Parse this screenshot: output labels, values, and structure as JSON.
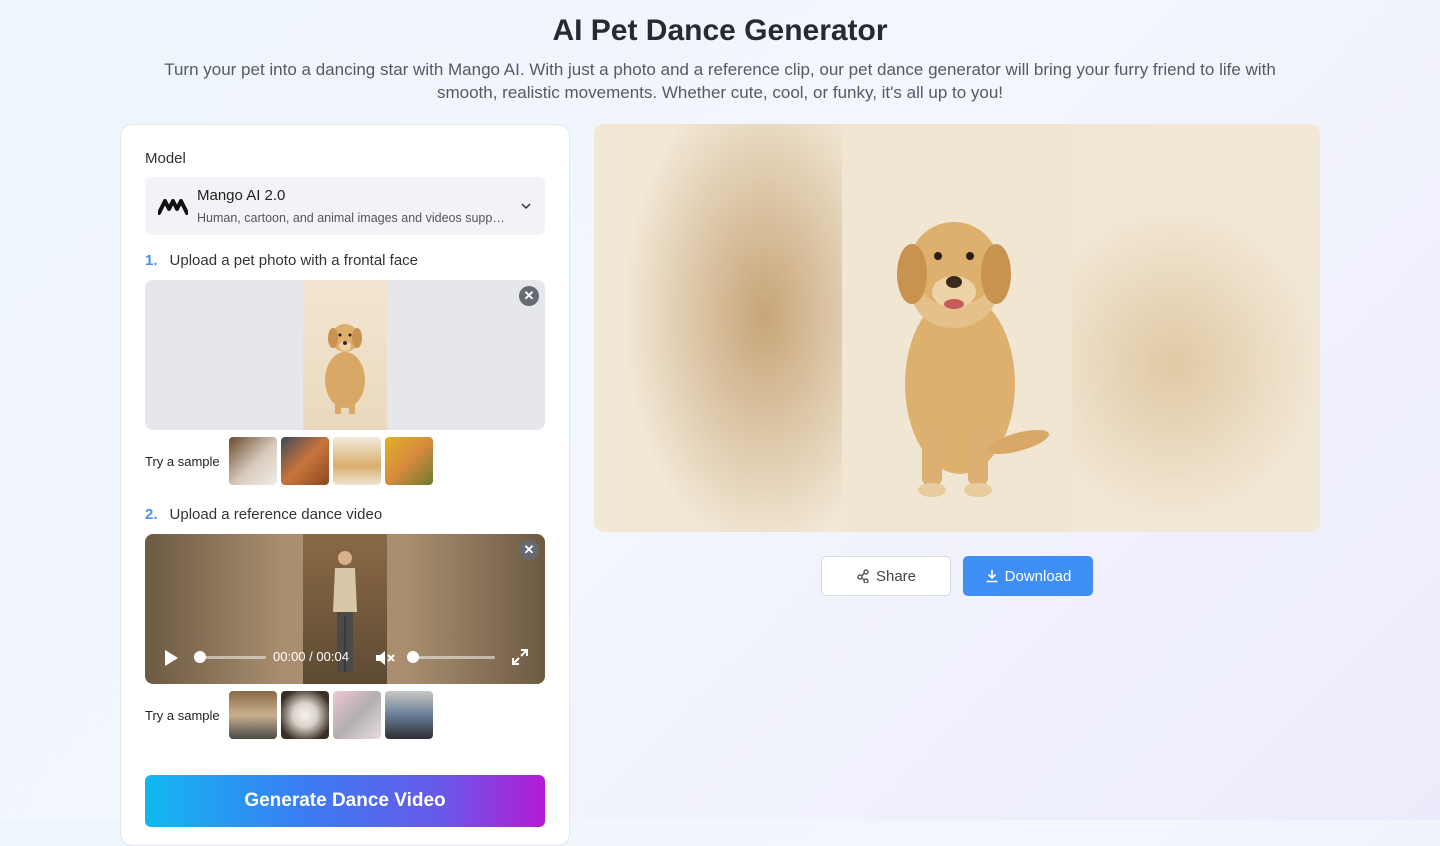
{
  "header": {
    "title": "AI Pet Dance Generator",
    "description": "Turn your pet into a dancing star with Mango AI. With just a photo and a reference clip, our pet dance generator will bring your furry friend to life with smooth, realistic movements. Whether cute, cool, or funky, it's all up to you!"
  },
  "model": {
    "label": "Model",
    "name": "Mango AI 2.0",
    "description": "Human, cartoon, and animal images and videos supported"
  },
  "step1": {
    "number": "1.",
    "label": "Upload a pet photo with a frontal face"
  },
  "step2": {
    "number": "2.",
    "label": "Upload a reference dance video"
  },
  "samples": {
    "label": "Try a sample"
  },
  "video": {
    "current_time": "00:00",
    "separator": "/",
    "duration": "00:04",
    "progress": 0,
    "volume": 0
  },
  "generate_label": "Generate Dance Video",
  "actions": {
    "share_label": "Share",
    "download_label": "Download"
  },
  "colors": {
    "accent": "#3d8ef5",
    "step_number": "#4a8ff1"
  }
}
